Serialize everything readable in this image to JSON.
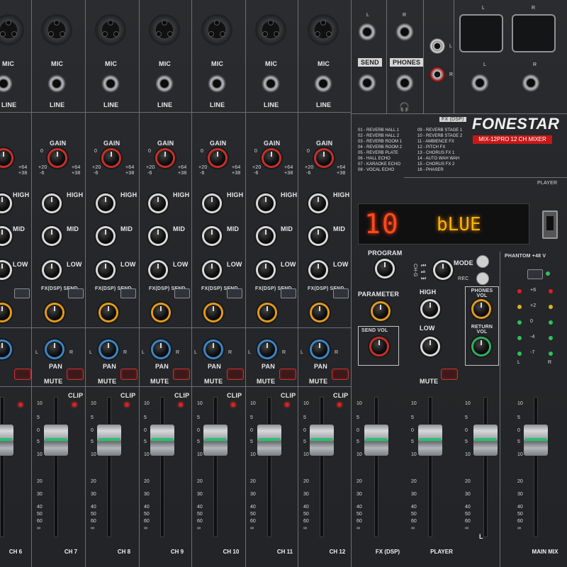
{
  "brand": "FONESTAR",
  "model": "MIX-12PRO 12 CH MIXER",
  "channels": [
    {
      "id": "ch6",
      "label": "CH 6"
    },
    {
      "id": "ch7",
      "label": "CH 7"
    },
    {
      "id": "ch8",
      "label": "CH 8"
    },
    {
      "id": "ch9",
      "label": "CH 9"
    },
    {
      "id": "ch10",
      "label": "CH 10"
    },
    {
      "id": "ch11",
      "label": "CH 11"
    },
    {
      "id": "ch12",
      "label": "CH 12"
    }
  ],
  "strip_labels": {
    "mic": "MIC",
    "line": "LINE",
    "gain": "GAIN",
    "high": "HIGH",
    "mid": "MID",
    "low": "LOW",
    "fx_send": "FX(DSP) SEND",
    "pan": "PAN",
    "mute": "MUTE",
    "clip": "CLIP",
    "gain_marks": {
      "zero": "0",
      "plus20": "+20",
      "plus64": "+64",
      "minus6": "-6",
      "plus38": "+38"
    },
    "pan_l": "L",
    "pan_r": "R"
  },
  "fader_scale": [
    "10",
    "5",
    "0",
    "5",
    "10",
    "20",
    "30",
    "40",
    "50",
    "60",
    "∞"
  ],
  "io": {
    "send": "SEND",
    "phones": "PHONES",
    "l": "L",
    "r": "R"
  },
  "fx": {
    "header": "FX (DSP)",
    "list_left": [
      "01 - REVERB HALL 1",
      "02 - REVERB HALL 2",
      "03 - REVERB ROOM 1",
      "04 - REVERB ROOM 2",
      "05 - REVERB PLATE",
      "06 - HALL ECHO",
      "07 - KARAOKE ECHO",
      "08 - VOCAL ECHO"
    ],
    "list_right": [
      "09 - REVERB STAGE 1",
      "10 - REVERB STAGE 2",
      "11 - AMBIENCE FX",
      "12 - PITCH FX",
      "13 - CHORUS FX 1",
      "14 - AUTO WAH WAH",
      "15 - CHORUS FX 2",
      "16 - PHASER"
    ],
    "program": "PROGRAM",
    "parameter": "PARAMETER",
    "send_vol": "SEND VOL",
    "footer": "FX (DSP)"
  },
  "player": {
    "header": "PLAYER",
    "display_number": "10",
    "display_text": "bLUE",
    "mode": "MODE",
    "rec": "REC",
    "high": "HIGH",
    "low": "LOW",
    "mute": "MUTE",
    "transport": "CH-G",
    "footer": "PLAYER",
    "phones_vol": "PHONES VOL",
    "return_vol": "RETURN VOL"
  },
  "main": {
    "phantom": "PHANTOM +48 V",
    "meter_labels": [
      "+6",
      "+2",
      "0",
      "-4",
      "-7"
    ],
    "l": "L",
    "r": "R",
    "footer": "MAIN MIX"
  }
}
